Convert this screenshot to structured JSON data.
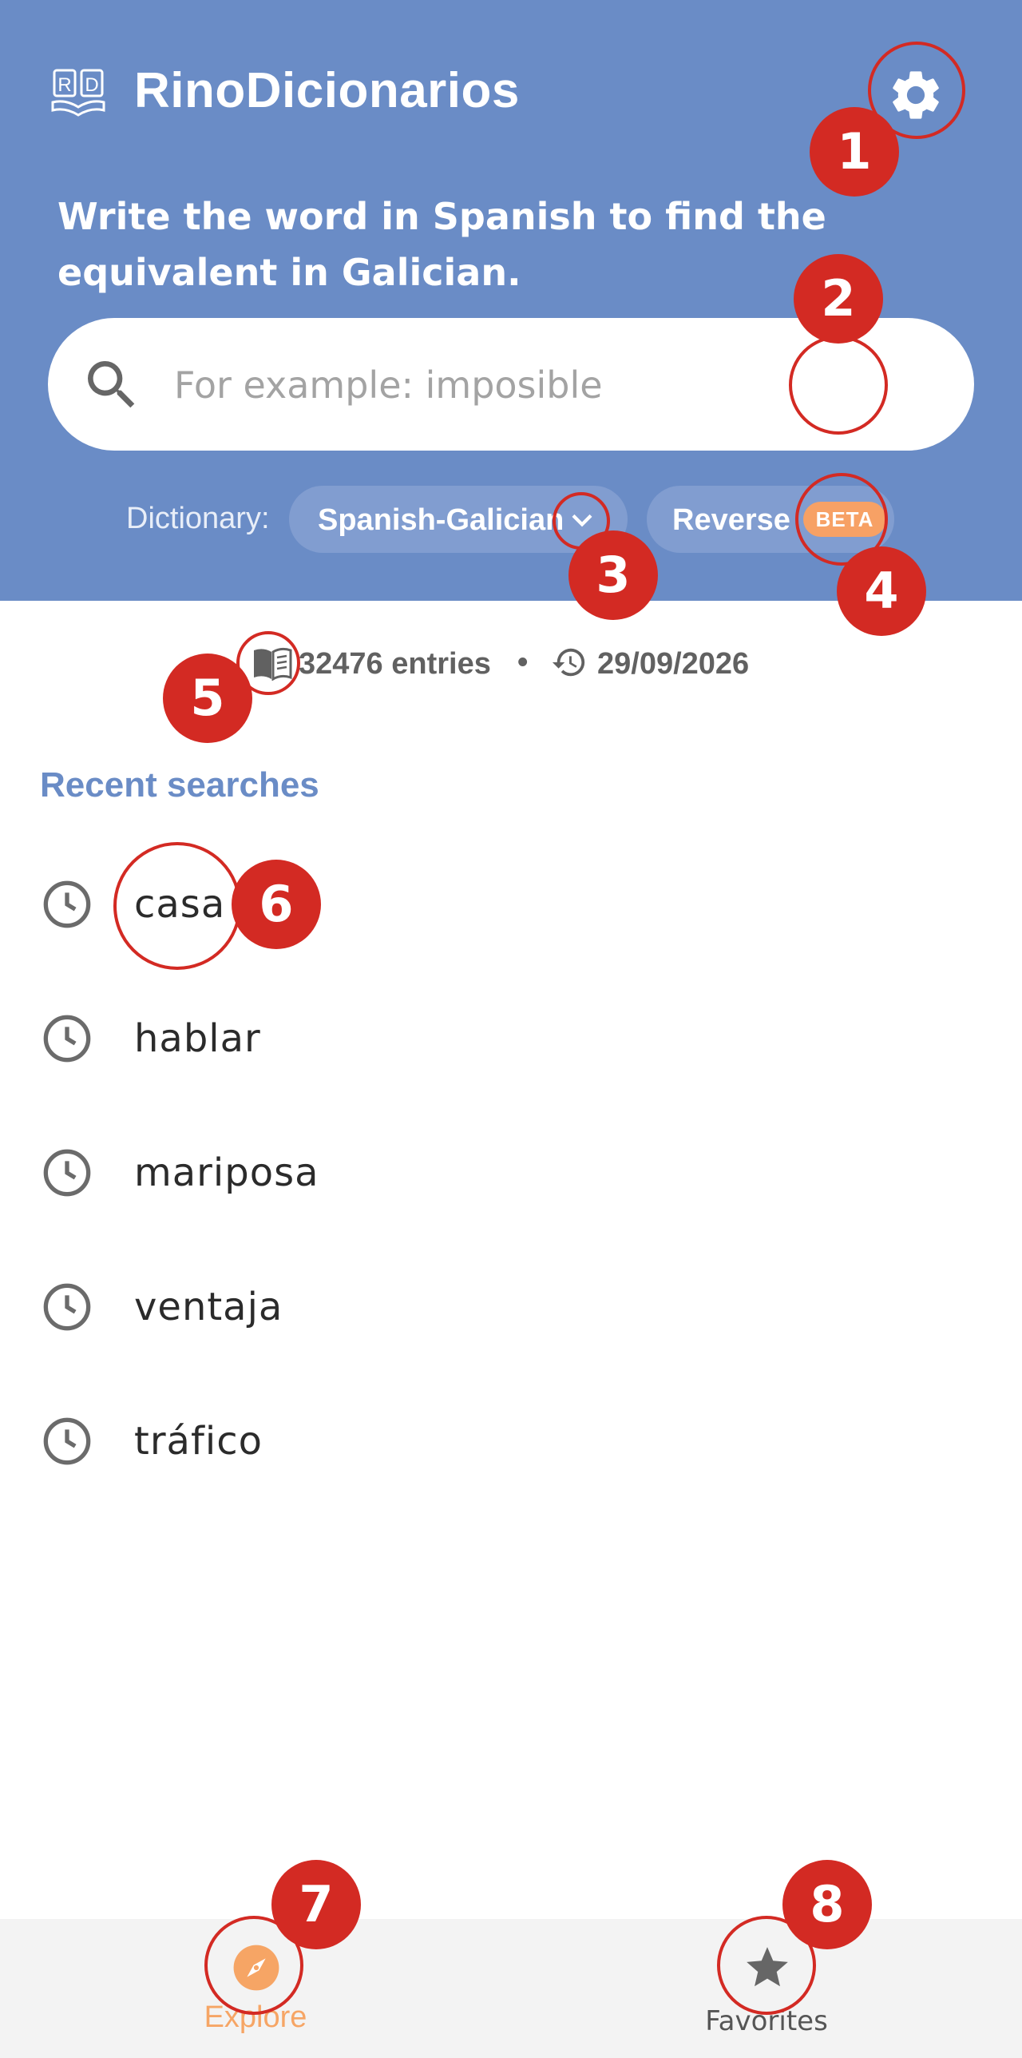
{
  "header": {
    "title": "RinoDicionarios",
    "subtitle": "Write the word in Spanish to find the equivalent in Galician.",
    "logo_icon": "dictionary-logo-icon",
    "settings_icon": "gear-icon",
    "background": "#6a8cc6"
  },
  "search": {
    "placeholder": "For example: imposible",
    "value": ""
  },
  "dictionary": {
    "label": "Dictionary:",
    "selected": "Spanish-Galician",
    "reverse_label": "Reverse",
    "reverse_badge": "BETA"
  },
  "stats": {
    "entries": "32476 entries",
    "separator": "•",
    "updated": "29/09/2026"
  },
  "recent": {
    "title": "Recent searches",
    "items": [
      "casa",
      "hablar",
      "mariposa",
      "ventaja",
      "tráfico"
    ]
  },
  "nav": {
    "explore_label": "Explore",
    "favorites_label": "Favorites",
    "active_color": "#f6a565"
  },
  "annotations": [
    "1",
    "2",
    "3",
    "4",
    "5",
    "6",
    "7",
    "8"
  ]
}
